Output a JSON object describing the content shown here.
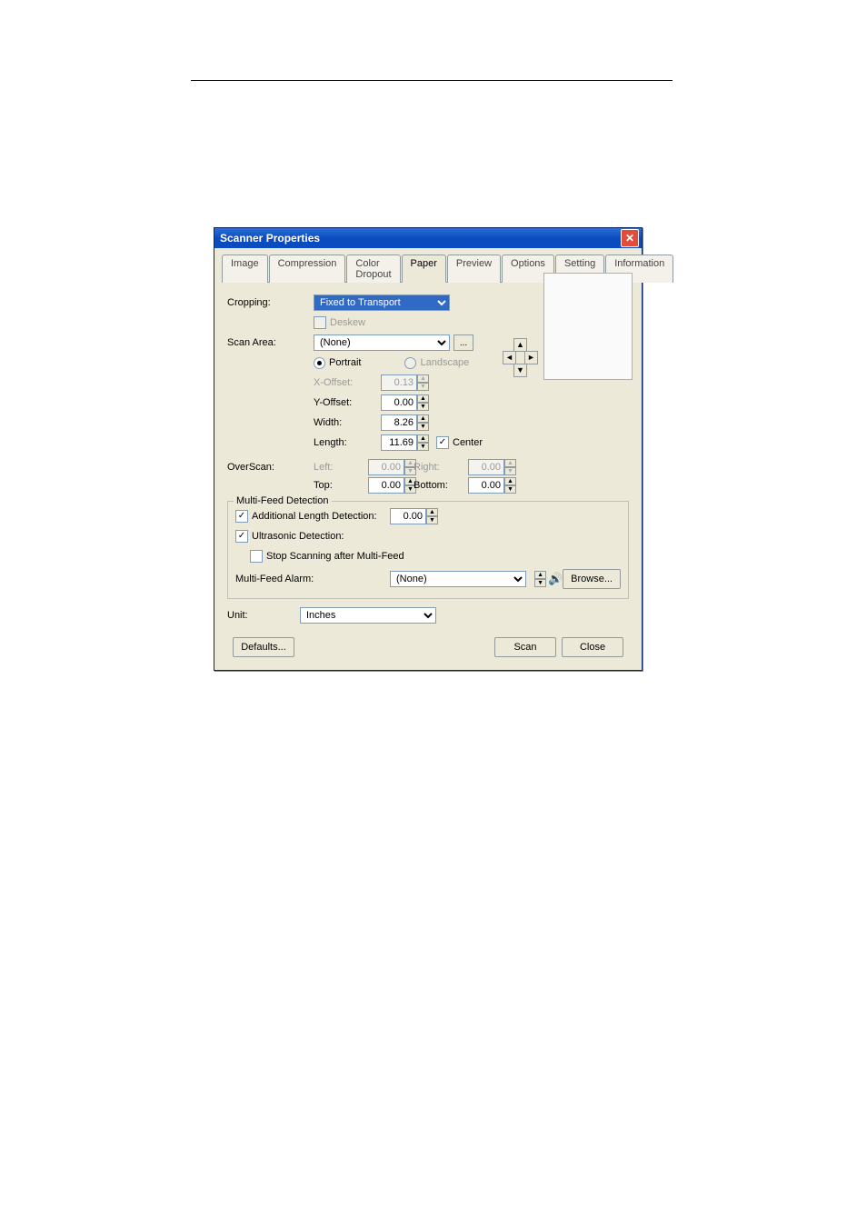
{
  "window": {
    "title": "Scanner Properties"
  },
  "tabs": {
    "image": "Image",
    "compression": "Compression",
    "colordropout": "Color Dropout",
    "paper": "Paper",
    "preview": "Preview",
    "options": "Options",
    "setting": "Setting",
    "information": "Information"
  },
  "labels": {
    "cropping": "Cropping:",
    "deskew": "Deskew",
    "scanarea": "Scan Area:",
    "portrait": "Portrait",
    "landscape": "Landscape",
    "xoffset": "X-Offset:",
    "yoffset": "Y-Offset:",
    "width": "Width:",
    "length": "Length:",
    "center": "Center",
    "overscan": "OverScan:",
    "left": "Left:",
    "right": "Right:",
    "top": "Top:",
    "bottom": "Bottom:",
    "multifeed_group": "Multi-Feed Detection",
    "additional_length": "Additional Length Detection:",
    "ultrasonic": "Ultrasonic Detection:",
    "stop_after_mf": "Stop Scanning after Multi-Feed",
    "mf_alarm": "Multi-Feed Alarm:",
    "unit": "Unit:",
    "ellipsis": "...",
    "browse": "Browse..."
  },
  "values": {
    "cropping": "Fixed to Transport",
    "scanarea": "(None)",
    "xoffset": "0.13",
    "yoffset": "0.00",
    "width": "8.26",
    "length": "11.69",
    "overscan_left": "0.00",
    "overscan_right": "0.00",
    "overscan_top": "0.00",
    "overscan_bottom": "0.00",
    "additional_length": "0.00",
    "mf_alarm": "(None)",
    "unit": "Inches"
  },
  "buttons": {
    "defaults": "Defaults...",
    "scan": "Scan",
    "close": "Close"
  }
}
